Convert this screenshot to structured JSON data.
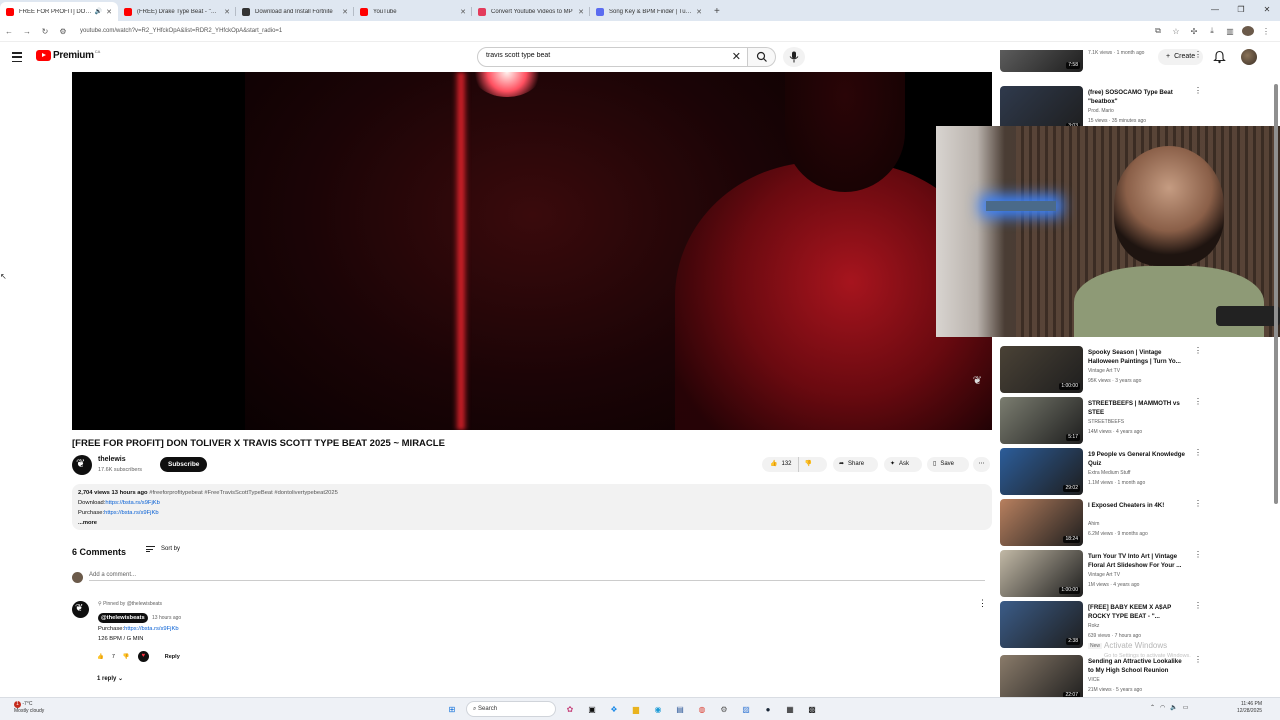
{
  "browser": {
    "tabs": [
      {
        "title": "FREE FOR PROFIT] DON T",
        "color": "#ff0000"
      },
      {
        "title": "(FREE) Drake Type Beat - \"CHA",
        "color": "#ff0000"
      },
      {
        "title": "Download and Install Fortnite",
        "color": "#333333"
      },
      {
        "title": "YouTube",
        "color": "#ff0000"
      },
      {
        "title": "Convert Youtube Videos to MP",
        "color": "#e33b5b"
      },
      {
        "title": "Song Key & BPM Finder | Tunel",
        "color": "#5b6cf0"
      }
    ],
    "new_tab": "+",
    "url": "youtube.com/watch?v=R2_YHfckOpA&list=RDR2_YHfckOpA&start_radio=1"
  },
  "masthead": {
    "brand": "Premium",
    "country": "CA",
    "search_value": "travis scott type beat",
    "create_label": "Create"
  },
  "video": {
    "title": "[FREE FOR PROFIT] DON TOLIVER X TRAVIS SCOTT TYPE BEAT 2025 ~ MIRACLE",
    "channel": "thelewis",
    "subscribers": "17.6K subscribers",
    "subscribe_label": "Subscribe",
    "likes": "132",
    "share_label": "Share",
    "ask_label": "Ask",
    "save_label": "Save"
  },
  "description": {
    "meta": "2,704 views  13 hours ago",
    "tags": "#freeforprofitypebeat #FreeTravisScottTypeBeat #dontolivertypebeat2025",
    "download_prefix": "Download:",
    "download_link": "https://bsta.rs/s9FjKb",
    "purchase_prefix": "Purchase:",
    "purchase_link": "https://bsta.rs/s9FjKb",
    "more_label": "...more"
  },
  "comments": {
    "count_label": "6 Comments",
    "sort_label": "Sort by",
    "add_placeholder": "Add a comment...",
    "pinned": {
      "pinned_by": "Pinned by @thelewisbeats",
      "author": "@thelewisbeats",
      "time": "13 hours ago",
      "purchase_prefix": "Purchase:",
      "purchase_link": "https://bsta.rs/s9FjKb",
      "line2": "126 BPM / G MIN",
      "likes": "7",
      "reply_label": "Reply",
      "replies_label": "1 reply"
    }
  },
  "recommendations": [
    {
      "title": "",
      "channel": "",
      "meta": "7.1K views · 1 month ago",
      "duration": "7:58"
    },
    {
      "title": "(free) SOSOCAMO Type Beat \"beatbox\"",
      "channel": "Prod. Mario",
      "meta": "15 views · 35 minutes ago",
      "duration": "3:03"
    },
    {
      "title": "Spooky Season | Vintage Halloween Paintings | Turn Yo...",
      "channel": "Vintage Art TV",
      "meta": "95K views · 3 years ago",
      "duration": "1:00:00"
    },
    {
      "title": "STREETBEEFS | MAMMOTH vs STEE",
      "channel": "STREETBEEFS",
      "meta": "14M views · 4 years ago",
      "duration": "5:17"
    },
    {
      "title": "19 People vs General Knowledge Quiz",
      "channel": "Extra Medium Stuff",
      "meta": "1.1M views · 1 month ago",
      "duration": "29:02"
    },
    {
      "title": "I Exposed Cheaters in 4K!",
      "channel": "Ahim",
      "meta": "6.2M views · 9 months ago",
      "duration": "18:24"
    },
    {
      "title": "Turn Your TV Into Art | Vintage Floral Art Slideshow For Your ...",
      "channel": "Vintage Art TV",
      "meta": "1M views · 4 years ago",
      "duration": "1:00:00"
    },
    {
      "title": "[FREE] BABY KEEM X A$AP ROCKY TYPE BEAT - \"...",
      "channel": "Rokz",
      "meta": "639 views · 7 hours ago",
      "badge": "New",
      "duration": "2:38"
    },
    {
      "title": "Sending an Attractive Lookalike to My High School Reunion",
      "channel": "VICE",
      "meta": "21M views · 5 years ago",
      "duration": "22:07"
    }
  ],
  "rec_thumb_colors": [
    "#6b6b6b",
    "#2f3a4d",
    "#4a4236",
    "#7b7d70",
    "#2c5d9a",
    "#b8805f",
    "#c2b9a6",
    "#3b5c88",
    "#8a7b6a"
  ],
  "watermark": {
    "title": "Activate Windows",
    "sub": "Go to Settings to activate Windows."
  },
  "taskbar": {
    "weather_badge": "1",
    "weather_temp": "-7°C",
    "weather_desc": "Mostly cloudy",
    "search_label": "Search",
    "time": "11:46 PM",
    "date": "12/28/2025"
  }
}
